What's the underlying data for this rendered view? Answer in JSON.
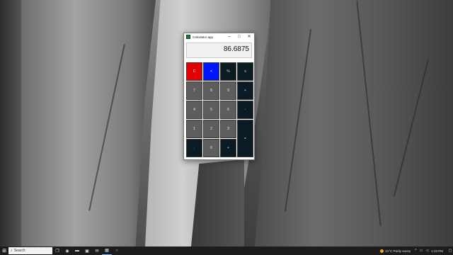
{
  "window": {
    "title": "Calculator app",
    "minimize": "–",
    "maximize": "□",
    "close": "✕"
  },
  "display": {
    "value": "86.6875"
  },
  "keys": [
    {
      "label": "C",
      "type": "clear"
    },
    {
      "label": "<",
      "type": "back"
    },
    {
      "label": "%",
      "type": "op"
    },
    {
      "label": "x",
      "type": "op"
    },
    {
      "label": "7",
      "type": "num"
    },
    {
      "label": "8",
      "type": "num"
    },
    {
      "label": "9",
      "type": "num"
    },
    {
      "label": "+",
      "type": "op"
    },
    {
      "label": "4",
      "type": "num"
    },
    {
      "label": "5",
      "type": "num"
    },
    {
      "label": "6",
      "type": "num"
    },
    {
      "label": "-",
      "type": "op"
    },
    {
      "label": "1",
      "type": "num"
    },
    {
      "label": "2",
      "type": "num"
    },
    {
      "label": "3",
      "type": "num"
    },
    {
      "label": "=",
      "type": "eq"
    },
    {
      "label": ".",
      "type": "op"
    },
    {
      "label": "0",
      "type": "num"
    },
    {
      "label": "+",
      "type": "op"
    }
  ],
  "taskbar": {
    "search_placeholder": "Search",
    "weather": "21°C  Partly sunny",
    "clock": "1:23 PM"
  },
  "colors": {
    "clear": "#e30000",
    "back": "#0014ff",
    "operator": "#0a1b24",
    "digit": "#5d5d5d"
  }
}
